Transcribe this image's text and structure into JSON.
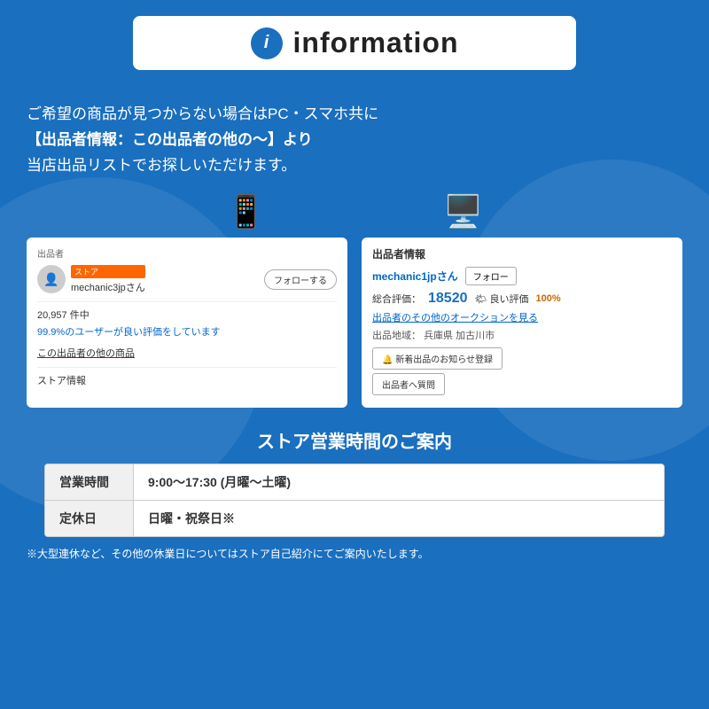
{
  "header": {
    "title": "information",
    "icon_text": "i"
  },
  "main_text": {
    "line1": "ご希望の商品が見つからない場合はPC・スマホ共に",
    "line2": "【出品者情報：この出品者の他の〜】より",
    "line3": "当店出品リストでお探しいただけます。"
  },
  "mobile_screenshot": {
    "label": "出品者",
    "store_badge": "ストア",
    "seller_name": "mechanic3jpさん",
    "follow_btn": "フォローする",
    "count": "20,957 件中",
    "rating_text": "99.9%のユーザーが良い評価をしています",
    "other_items": "この出品者の他の商品",
    "store_info": "ストア情報"
  },
  "pc_screenshot": {
    "header": "出品者情報",
    "seller_name": "mechanic1jpさん",
    "follow_btn": "フォロー",
    "rating_label": "総合評価：",
    "rating_num": "18520",
    "good_label": "🌤 良い評価",
    "good_pct": "100%",
    "auction_link": "出品者のその他のオークションを見る",
    "location_label": "出品地域：",
    "location": "兵庫県 加古川市",
    "notify_btn": "🔔 新着出品のお知らせ登録",
    "question_btn": "出品者へ質問"
  },
  "store_hours": {
    "title": "ストア営業時間のご案内",
    "rows": [
      {
        "label": "営業時間",
        "value": "9:00〜17:30 (月曜〜土曜)"
      },
      {
        "label": "定休日",
        "value": "日曜・祝祭日※"
      }
    ]
  },
  "footer_note": "※大型連休など、その他の休業日についてはストア自己紹介にてご案内いたします。"
}
